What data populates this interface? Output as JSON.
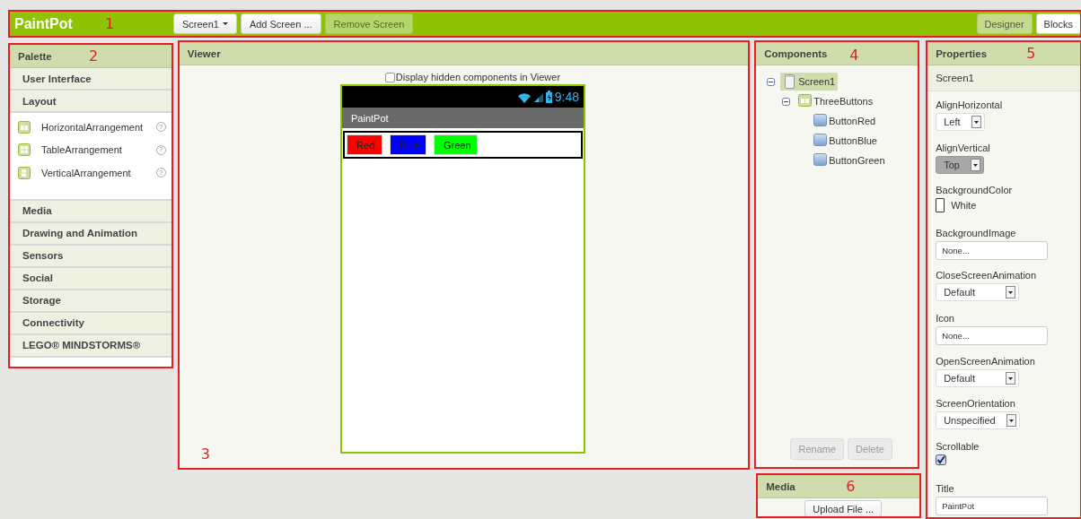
{
  "topbar": {
    "app_name": "PaintPot",
    "callout": "1",
    "screen_buttons": [
      {
        "label": "Screen1",
        "kind": "dropdown",
        "disabled": false
      },
      {
        "label": "Add Screen ...",
        "kind": "button",
        "disabled": false
      },
      {
        "label": "Remove Screen",
        "kind": "button",
        "disabled": true
      }
    ],
    "view_tabs": [
      {
        "label": "Designer",
        "selected": true
      },
      {
        "label": "Blocks",
        "selected": false
      }
    ]
  },
  "palette": {
    "title": "Palette",
    "callout": "2",
    "categories": [
      {
        "label": "User Interface"
      },
      {
        "label": "Layout",
        "items": [
          {
            "label": "HorizontalArrangement",
            "kind": "horizontal",
            "help": "?"
          },
          {
            "label": "TableArrangement",
            "kind": "table",
            "help": "?"
          },
          {
            "label": "VerticalArrangement",
            "kind": "vertical",
            "help": "?"
          }
        ]
      },
      {
        "label": "Media"
      },
      {
        "label": "Drawing and Animation"
      },
      {
        "label": "Sensors"
      },
      {
        "label": "Social"
      },
      {
        "label": "Storage"
      },
      {
        "label": "Connectivity"
      },
      {
        "label": "LEGO® MINDSTORMS®"
      }
    ]
  },
  "viewer": {
    "title": "Viewer",
    "callout": "3",
    "show_hidden": {
      "label": "Display hidden components in Viewer",
      "checked": false
    },
    "phone": {
      "time": "9:48",
      "title": "PaintPot",
      "buttons": [
        {
          "label": "Red",
          "color": "#ff0000"
        },
        {
          "label": "Blue",
          "color": "#0000ff"
        },
        {
          "label": "Green",
          "color": "#00ff00"
        }
      ]
    }
  },
  "components": {
    "title": "Components",
    "callout": "4",
    "tree": [
      {
        "label": "Screen1",
        "kind": "screen",
        "selected": true,
        "expanded": true,
        "children": [
          {
            "label": "ThreeButtons",
            "kind": "arrangement",
            "selected": false,
            "expanded": true,
            "children": [
              {
                "label": "ButtonRed",
                "kind": "button",
                "selected": false
              },
              {
                "label": "ButtonBlue",
                "kind": "button",
                "selected": false
              },
              {
                "label": "ButtonGreen",
                "kind": "button",
                "selected": false
              }
            ]
          }
        ]
      }
    ],
    "buttons": [
      {
        "label": "Rename",
        "disabled": true
      },
      {
        "label": "Delete",
        "disabled": true
      }
    ]
  },
  "media": {
    "title": "Media",
    "callout": "6",
    "upload_button": "Upload File ..."
  },
  "properties": {
    "title": "Properties",
    "callout": "5",
    "component": "Screen1",
    "items": [
      {
        "name": "AlignHorizontal",
        "kind": "dropdown",
        "value": "Left",
        "disabled": false
      },
      {
        "name": "AlignVertical",
        "kind": "dropdown",
        "value": "Top",
        "disabled": true
      },
      {
        "name": "BackgroundColor",
        "kind": "color",
        "value": "White",
        "color": "#ffffff"
      },
      {
        "name": "BackgroundImage",
        "kind": "text",
        "value": "None..."
      },
      {
        "name": "CloseScreenAnimation",
        "kind": "dropdown",
        "value": "Default",
        "disabled": false
      },
      {
        "name": "Icon",
        "kind": "text",
        "value": "None..."
      },
      {
        "name": "OpenScreenAnimation",
        "kind": "dropdown",
        "value": "Default",
        "disabled": false
      },
      {
        "name": "ScreenOrientation",
        "kind": "dropdown",
        "value": "Unspecified",
        "disabled": false
      },
      {
        "name": "Scrollable",
        "kind": "checkbox",
        "checked": true
      },
      {
        "name": "Title",
        "kind": "text",
        "value": "PaintPot"
      }
    ]
  }
}
